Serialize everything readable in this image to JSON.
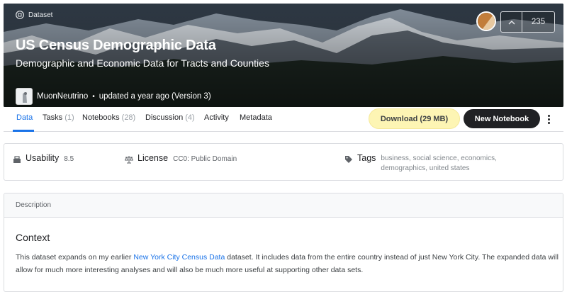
{
  "hero": {
    "kind_label": "Dataset",
    "title": "US Census Demographic Data",
    "subtitle": "Demographic and Economic Data for Tracts and Counties",
    "owner": "MuonNeutrino",
    "meta_dot": "•",
    "updated": "updated a year ago (Version 3)",
    "vote_count": "235",
    "icons": {
      "kind": "dataset-icon",
      "owner_avatar": "owner-avatar",
      "upvote": "chevron-up-icon"
    }
  },
  "tabs": [
    {
      "label": "Data",
      "count": ""
    },
    {
      "label": "Tasks",
      "count": "(1)"
    },
    {
      "label": "Notebooks",
      "count": "(28)"
    },
    {
      "label": "Discussion",
      "count": "(4)"
    },
    {
      "label": "Activity",
      "count": ""
    },
    {
      "label": "Metadata",
      "count": ""
    }
  ],
  "actions": {
    "download_label": "Download (29 MB)",
    "new_notebook_label": "New Notebook",
    "more_icon": "more-vertical-icon"
  },
  "info": {
    "usability_label": "Usability",
    "usability_value": "8.5",
    "license_label": "License",
    "license_value": "CC0: Public Domain",
    "tags_label": "Tags",
    "tags": [
      "business",
      "social science",
      "economics",
      "demographics",
      "united states"
    ],
    "icons": {
      "usability": "usability-icon",
      "license": "scale-icon",
      "tags": "tag-icon"
    }
  },
  "description": {
    "header": "Description",
    "heading": "Context",
    "text_before_link": "This dataset expands on my earlier ",
    "link_text": "New York City Census Data",
    "text_after_link": " dataset. It includes data from the entire country instead of just New York City. The expanded data will allow for much more interesting analyses and will also be much more useful at supporting other data sets."
  },
  "colors": {
    "accent": "#1a73e8",
    "download_bg": "#fdf5b4",
    "new_notebook_bg": "#202124"
  }
}
